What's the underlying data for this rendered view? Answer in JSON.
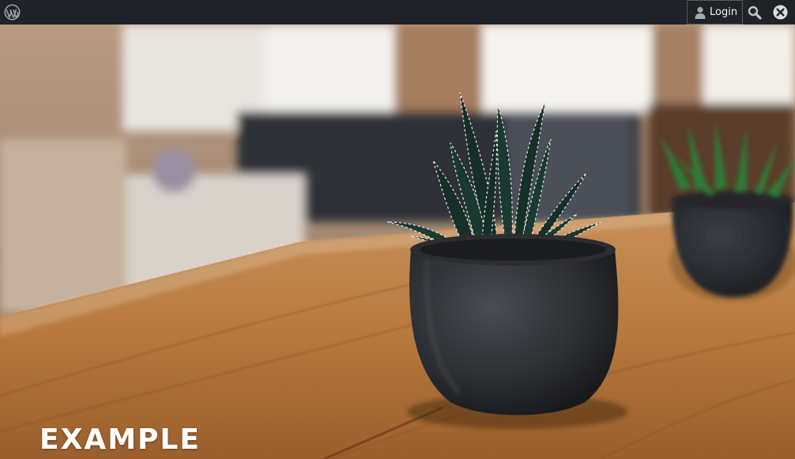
{
  "admin_bar": {
    "logo_icon": "wordpress-icon",
    "login_label": "Login",
    "login_icon": "user-icon",
    "search_icon": "search-icon",
    "close_icon": "close-icon"
  },
  "hero": {
    "site_title": "EXAMPLE"
  }
}
